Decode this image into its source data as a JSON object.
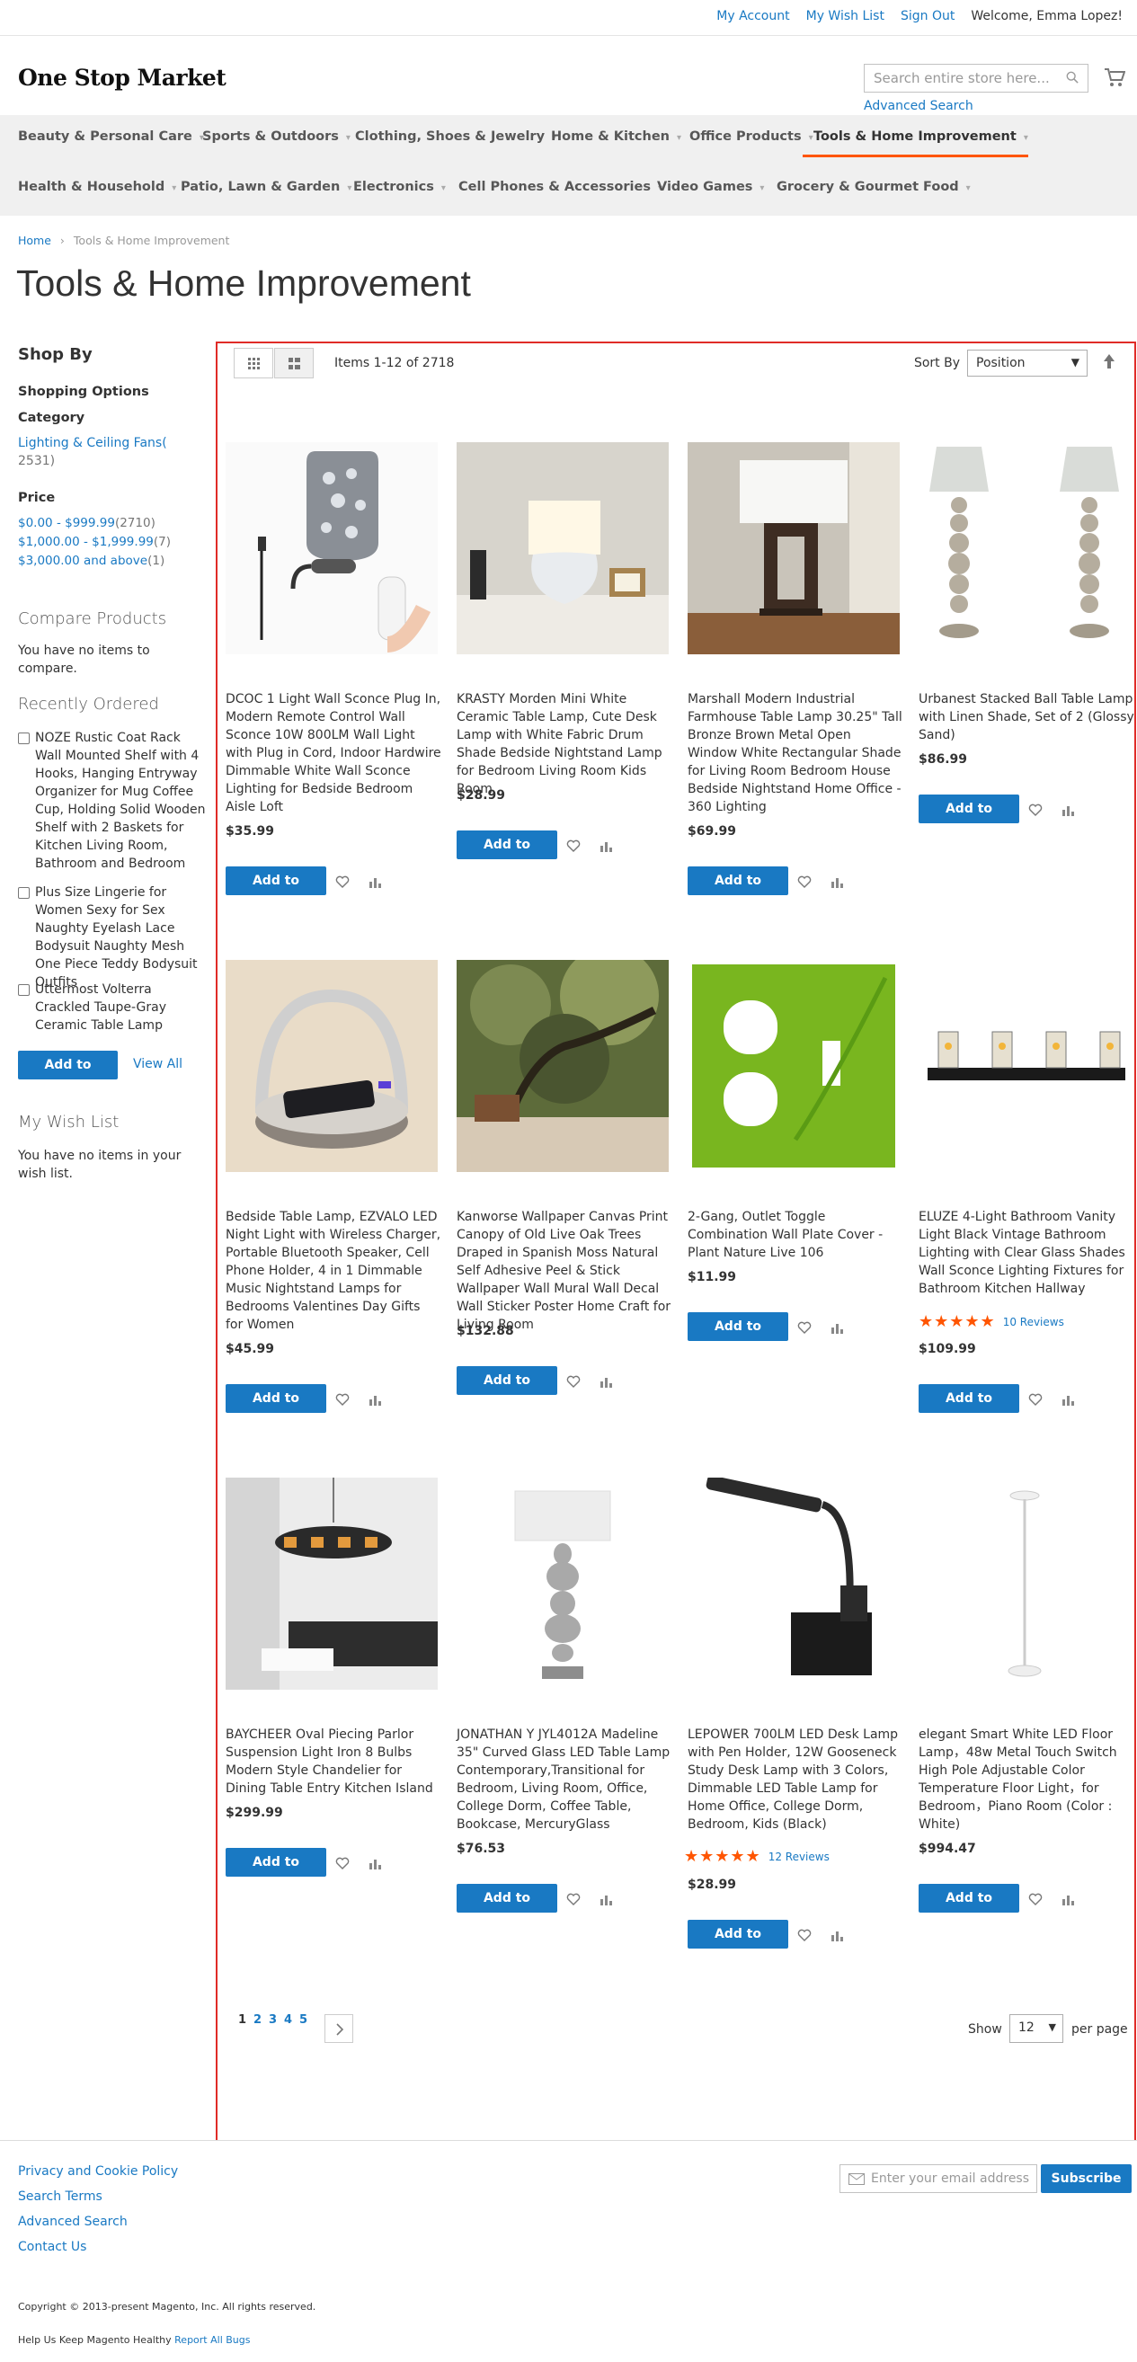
{
  "topbar": {
    "my_account": "My Account",
    "my_wish_list": "My Wish List",
    "sign_out": "Sign Out",
    "welcome": "Welcome, Emma Lopez!"
  },
  "header": {
    "logo": "One Stop Market",
    "search_placeholder": "Search entire store here...",
    "advanced_search": "Advanced Search"
  },
  "nav": [
    {
      "label": "Beauty & Personal Care",
      "active": false
    },
    {
      "label": "Sports & Outdoors",
      "active": false
    },
    {
      "label": "Clothing, Shoes & Jewelry",
      "active": false
    },
    {
      "label": "Home & Kitchen",
      "active": false
    },
    {
      "label": "Office Products",
      "active": false
    },
    {
      "label": "Tools & Home Improvement",
      "active": true
    },
    {
      "label": "Health & Household",
      "active": false
    },
    {
      "label": "Patio, Lawn & Garden",
      "active": false
    },
    {
      "label": "Electronics",
      "active": false
    },
    {
      "label": "Cell Phones & Accessories",
      "active": false
    },
    {
      "label": "Video Games",
      "active": false
    },
    {
      "label": "Grocery & Gourmet Food",
      "active": false
    }
  ],
  "breadcrumb": {
    "home": "Home",
    "current": "Tools & Home Improvement"
  },
  "page_title": "Tools & Home Improvement",
  "sidebar": {
    "shop_by": "Shop By",
    "shopping_options": "Shopping Options",
    "category_label": "Category",
    "category_item": "Lighting & Ceiling Fans",
    "category_count": "2531",
    "price_label": "Price",
    "prices": [
      {
        "range": "$0.00 - $999.99",
        "count": "2710"
      },
      {
        "range": "$1,000.00 - $1,999.99",
        "count": "7"
      },
      {
        "range": "$3,000.00 and above",
        "count": "1"
      }
    ],
    "compare_title": "Compare Products",
    "compare_empty": "You have no items to compare.",
    "recent_title": "Recently Ordered",
    "recent_items": [
      "NOZE Rustic Coat Rack Wall Mounted Shelf with 4 Hooks, Hanging Entryway Organizer for Mug Coffee Cup, Holding Solid Wooden Shelf with 2 Baskets for Kitchen Living Room, Bathroom and Bedroom",
      "Plus Size Lingerie for Women Sexy for Sex Naughty Eyelash Lace Bodysuit Naughty Mesh One Piece Teddy Bodysuit Outfits",
      "Uttermost Volterra Crackled Taupe-Gray Ceramic Table Lamp"
    ],
    "add_to_cart": "Add to Cart",
    "view_all": "View All",
    "wishlist_title": "My Wish List",
    "wishlist_empty": "You have no items in your wish list."
  },
  "toolbar": {
    "items": "Items 1-12 of 2718",
    "sort_by": "Sort By",
    "sort_value": "Position"
  },
  "products": [
    {
      "name": "DCOC 1 Light Wall Sconce Plug In, Modern Remote Control Wall Sconce 10W 800LM Wall Light with Plug in Cord, Indoor Hardwire Dimmable White Wall Sconce Lighting for Bedside Bedroom Aisle Loft",
      "price": "$35.99",
      "rating": null,
      "reviews": ""
    },
    {
      "name": "KRASTY Morden Mini White Ceramic Table Lamp, Cute Desk Lamp with White Fabric Drum Shade Bedside Nightstand Lamp for Bedroom Living Room Kids Room",
      "price": "$28.99",
      "rating": null,
      "reviews": ""
    },
    {
      "name": "Marshall Modern Industrial Farmhouse Table Lamp 30.25\" Tall Bronze Brown Metal Open Window White Rectangular Shade for Living Room Bedroom House Bedside Nightstand Home Office - 360 Lighting",
      "price": "$69.99",
      "rating": null,
      "reviews": ""
    },
    {
      "name": "Urbanest Stacked Ball Table Lamp with Linen Shade, Set of 2 (Glossy Sand)",
      "price": "$86.99",
      "rating": null,
      "reviews": ""
    },
    {
      "name": "Bedside Table Lamp, EZVALO LED Night Light with Wireless Charger, Portable Bluetooth Speaker, Cell Phone Holder, 4 in 1 Dimmable Music Nightstand Lamps for Bedrooms Valentines Day Gifts for Women",
      "price": "$45.99",
      "rating": null,
      "reviews": ""
    },
    {
      "name": "Kanworse Wallpaper Canvas Print Canopy of Old Live Oak Trees Draped in Spanish Moss Natural Self Adhesive Peel & Stick Wallpaper Wall Mural Wall Decal Wall Sticker Poster Home Craft for Living Room",
      "price": "$132.88",
      "rating": null,
      "reviews": ""
    },
    {
      "name": "2-Gang, Outlet Toggle Combination Wall Plate Cover - Plant Nature Live 106",
      "price": "$11.99",
      "rating": null,
      "reviews": ""
    },
    {
      "name": "ELUZE 4-Light Bathroom Vanity Light Black Vintage Bathroom Lighting with Clear Glass Shades Wall Sconce Lighting Fixtures for Bathroom Kitchen Hallway",
      "price": "$109.99",
      "rating": 5,
      "reviews": "10  Reviews"
    },
    {
      "name": "BAYCHEER Oval Piecing Parlor Suspension Light Iron 8 Bulbs Modern Style Chandelier for Dining Table Entry Kitchen Island",
      "price": "$299.99",
      "rating": null,
      "reviews": ""
    },
    {
      "name": "JONATHAN Y JYL4012A Madeline 35\" Curved Glass LED Table Lamp Contemporary,Transitional for Bedroom, Living Room, Office, College Dorm, Coffee Table, Bookcase, MercuryGlass",
      "price": "$76.53",
      "rating": null,
      "reviews": ""
    },
    {
      "name": "LEPOWER 700LM LED Desk Lamp with Pen Holder, 12W Gooseneck Study Desk Lamp with 3 Colors, Dimmable LED Table Lamp for Home Office, College Dorm, Bedroom, Kids (Black)",
      "price": "$28.99",
      "rating": 5,
      "reviews": "12  Reviews"
    },
    {
      "name": "elegant Smart White LED Floor Lamp，48w Metal Touch Switch High Pole Adjustable Color Temperature Floor Light，for Bedroom，Piano Room (Color : White)",
      "price": "$994.47",
      "rating": null,
      "reviews": ""
    }
  ],
  "product_add_label": "Add to Cart",
  "pager": {
    "pages": [
      "1",
      "2",
      "3",
      "4",
      "5"
    ],
    "current": "1",
    "show": "Show",
    "limit": "12",
    "per_page": "per page"
  },
  "footer": {
    "links": [
      "Privacy and Cookie Policy",
      "Search Terms",
      "Advanced Search",
      "Contact Us"
    ],
    "newsletter_placeholder": "Enter your email address",
    "subscribe": "Subscribe",
    "copyright": "Copyright © 2013-present Magento, Inc. All rights reserved.",
    "help_prefix": "Help Us Keep Magento Healthy",
    "report_bugs": "Report All Bugs"
  },
  "colors": {
    "accent": "#1979c3",
    "active_underline": "#ff5501",
    "star": "#ff5501",
    "outline": "#e02b27"
  }
}
